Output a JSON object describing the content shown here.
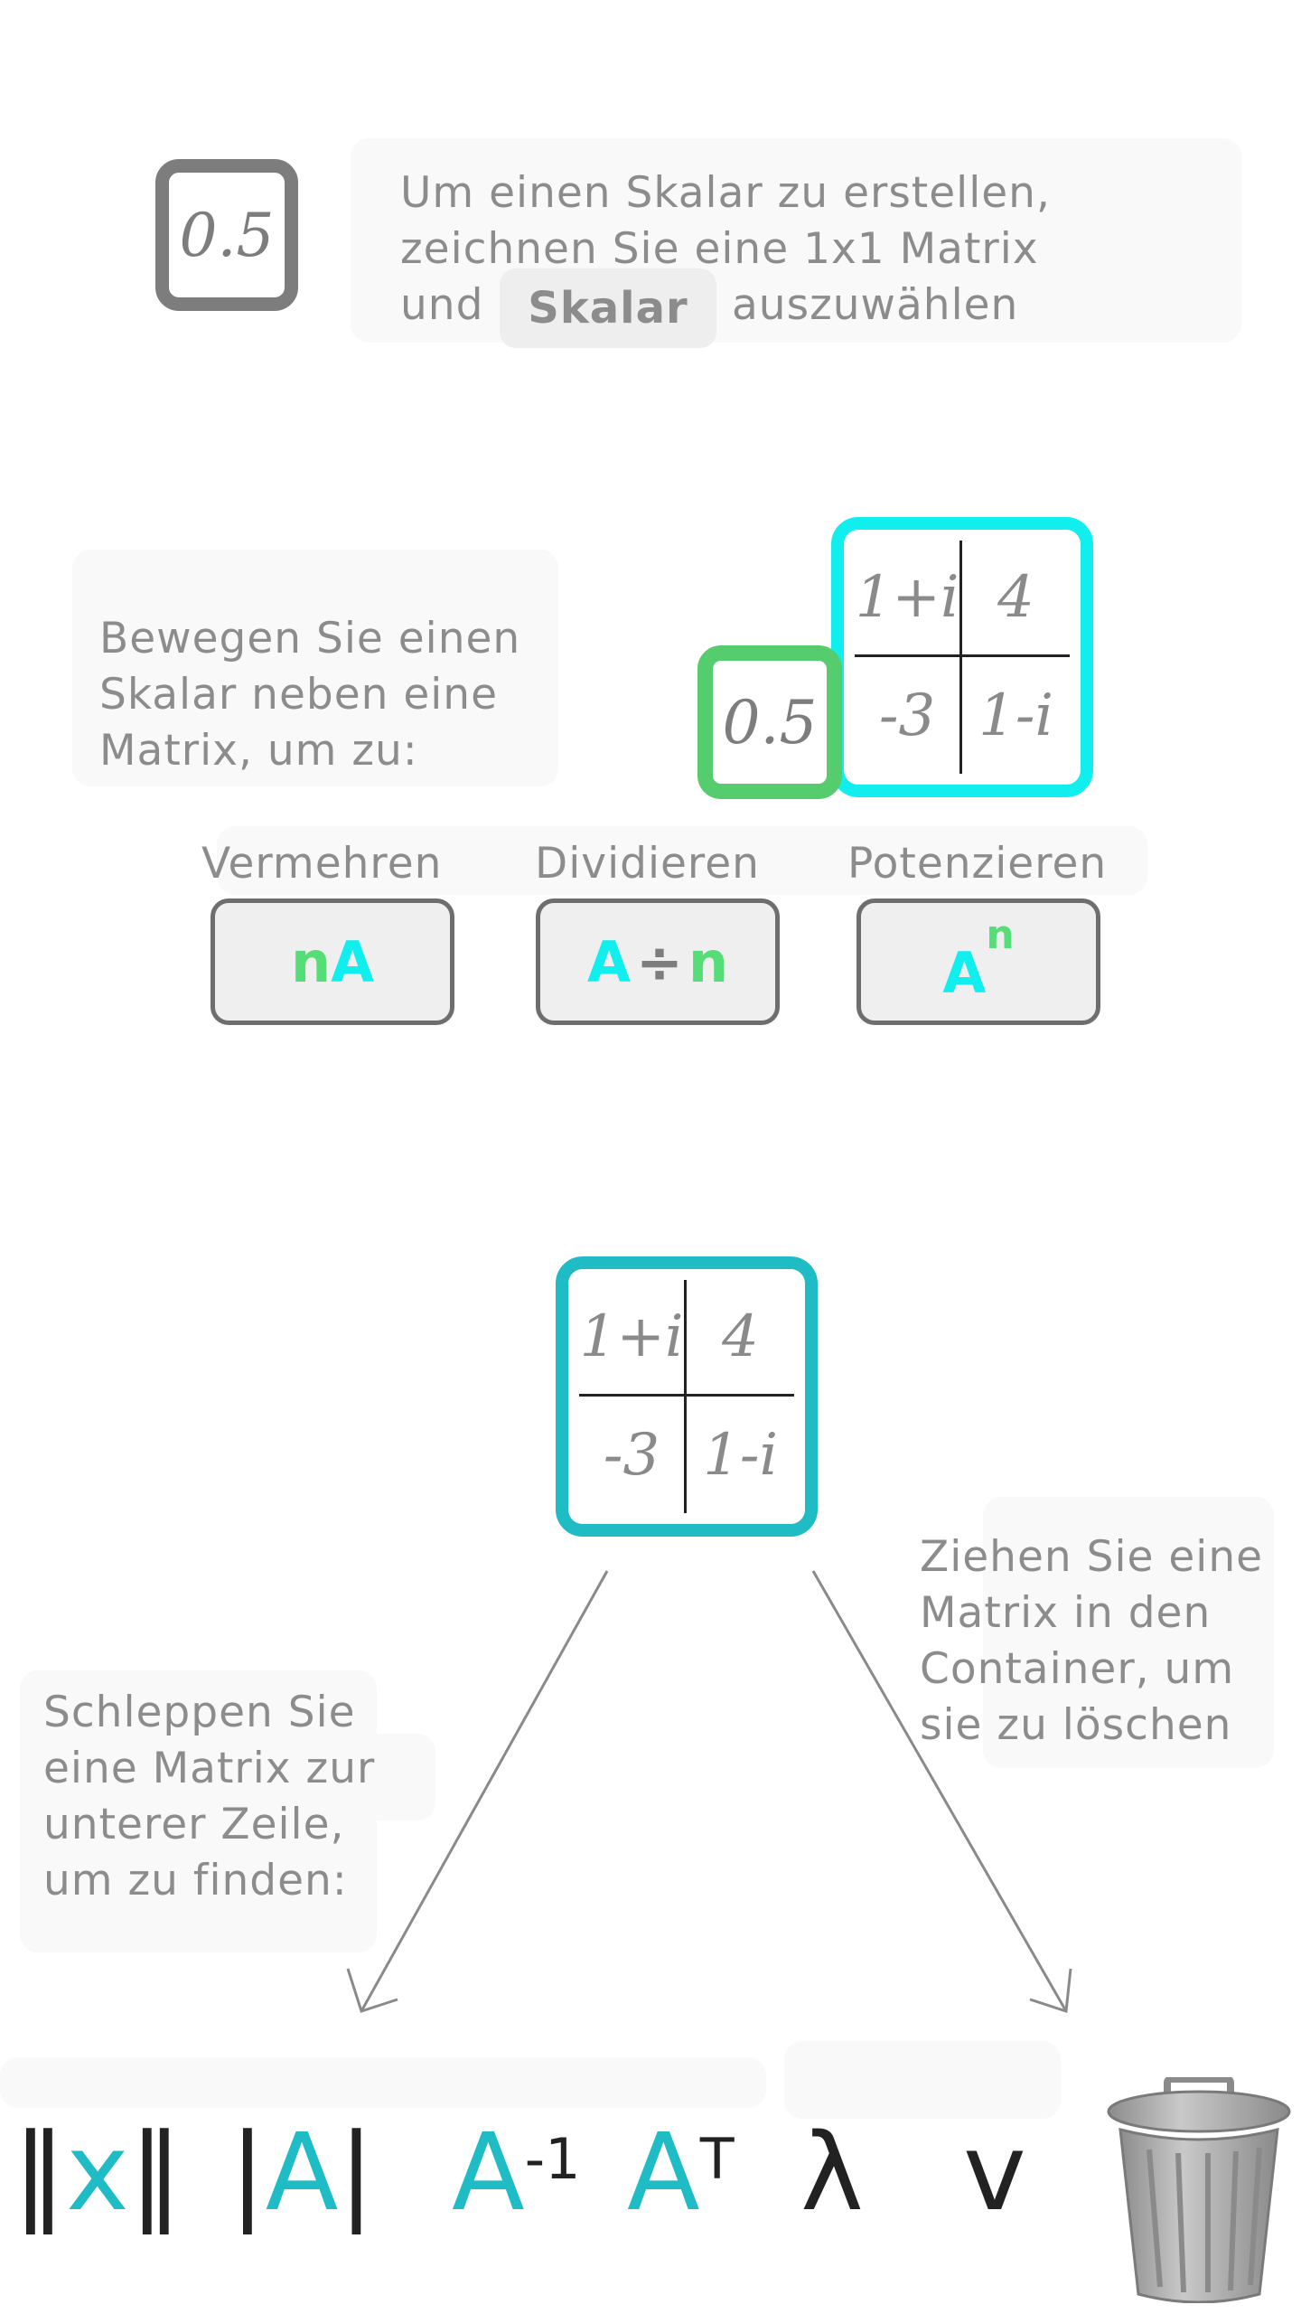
{
  "scalar_hint": {
    "icon_value": "0.5",
    "line1": "Um einen Skalar zu erstellen,",
    "line2": "zeichnen Sie eine 1x1 Matrix",
    "line3_prefix": "und",
    "chip": "Skalar",
    "line3_suffix": "auszuwählen"
  },
  "move_hint": {
    "line1": "Bewegen Sie einen",
    "line2": "Skalar neben eine",
    "line3": "Matrix, um zu:"
  },
  "scalar_example": "0.5",
  "matrix": {
    "cells": [
      "1+i",
      "4",
      "-3",
      "1-i"
    ]
  },
  "operations": [
    {
      "label": "Vermehren",
      "parts": [
        "n",
        "A"
      ]
    },
    {
      "label": "Dividieren",
      "parts": [
        "A",
        "÷",
        "n"
      ]
    },
    {
      "label": "Potenzieren",
      "parts": [
        "A",
        "n"
      ]
    }
  ],
  "find_hint": {
    "line1": "Schleppen Sie",
    "line2": "eine Matrix zur",
    "line3": "unterer Zeile,",
    "line4": "um zu finden:"
  },
  "delete_hint": {
    "line1": "Ziehen Sie eine",
    "line2": "Matrix in den",
    "line3": "Container, um",
    "line4": "sie zu löschen"
  },
  "bottom_ops": {
    "norm": {
      "left": "‖",
      "var": "x",
      "right": "‖"
    },
    "determinant": {
      "left": "|",
      "var": "A",
      "right": "|"
    },
    "inverse": {
      "var": "A",
      "sup": "-1"
    },
    "transpose": {
      "var": "A",
      "sup": "T"
    },
    "eigenvalue": "λ",
    "eigenvector": "v"
  },
  "colors": {
    "teal": "#1fbcc6",
    "cyan": "#11eeee",
    "green": "#55dd77",
    "hint_text": "#8c8c8c"
  }
}
